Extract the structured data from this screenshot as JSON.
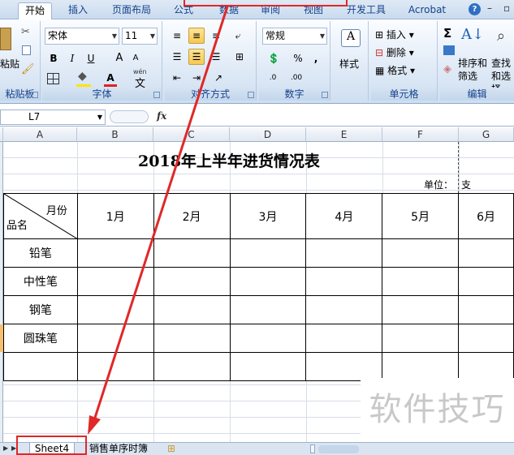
{
  "tabs": [
    {
      "label": "开始",
      "active": true
    },
    {
      "label": "插入"
    },
    {
      "label": "页面布局"
    },
    {
      "label": "公式"
    },
    {
      "label": "数据"
    },
    {
      "label": "审阅"
    },
    {
      "label": "视图"
    },
    {
      "label": "开发工具"
    },
    {
      "label": "Acrobat"
    }
  ],
  "help_icon": "?",
  "ribbon": {
    "paste_label": "粘贴",
    "clipboard_label": "粘贴板",
    "font_name": "宋体",
    "font_size": "11",
    "font_group_label": "字体",
    "align_group_label": "对齐方式",
    "number_format": "常规",
    "number_group_label": "数字",
    "styles_label": "样式",
    "insert_label": "插入",
    "delete_label": "删除",
    "format_label": "格式",
    "cells_group_label": "单元格",
    "sort_filter_label": "排序和筛选",
    "find_select_label": "查找和选择",
    "sigma": "Σ",
    "editing_group_label": "编辑",
    "bold": "B",
    "italic": "I",
    "underline": "U",
    "grow_font": "A",
    "shrink_font": "A",
    "font_color": "A",
    "percent": "%",
    "comma": ",",
    "wen": "wén",
    "wen_char": "文"
  },
  "formula_bar": {
    "cell_ref": "L7",
    "fx": "fx"
  },
  "columns": [
    "A",
    "B",
    "C",
    "D",
    "E",
    "F",
    "G"
  ],
  "sheet": {
    "title": "2018年上半年进货情况表",
    "unit_label": "单位：",
    "unit_value": "支",
    "header_month": "月份",
    "header_item": "品名",
    "months": [
      "1月",
      "2月",
      "3月",
      "4月",
      "5月",
      "6月"
    ],
    "items": [
      "铅笔",
      "中性笔",
      "钢笔",
      "圆珠笔",
      ""
    ]
  },
  "sheet_tabs": [
    {
      "label": "Sheet4",
      "active": true
    },
    {
      "label": "销售单序时簿"
    }
  ],
  "watermark": "软件技巧",
  "accent_red": "#e02828"
}
